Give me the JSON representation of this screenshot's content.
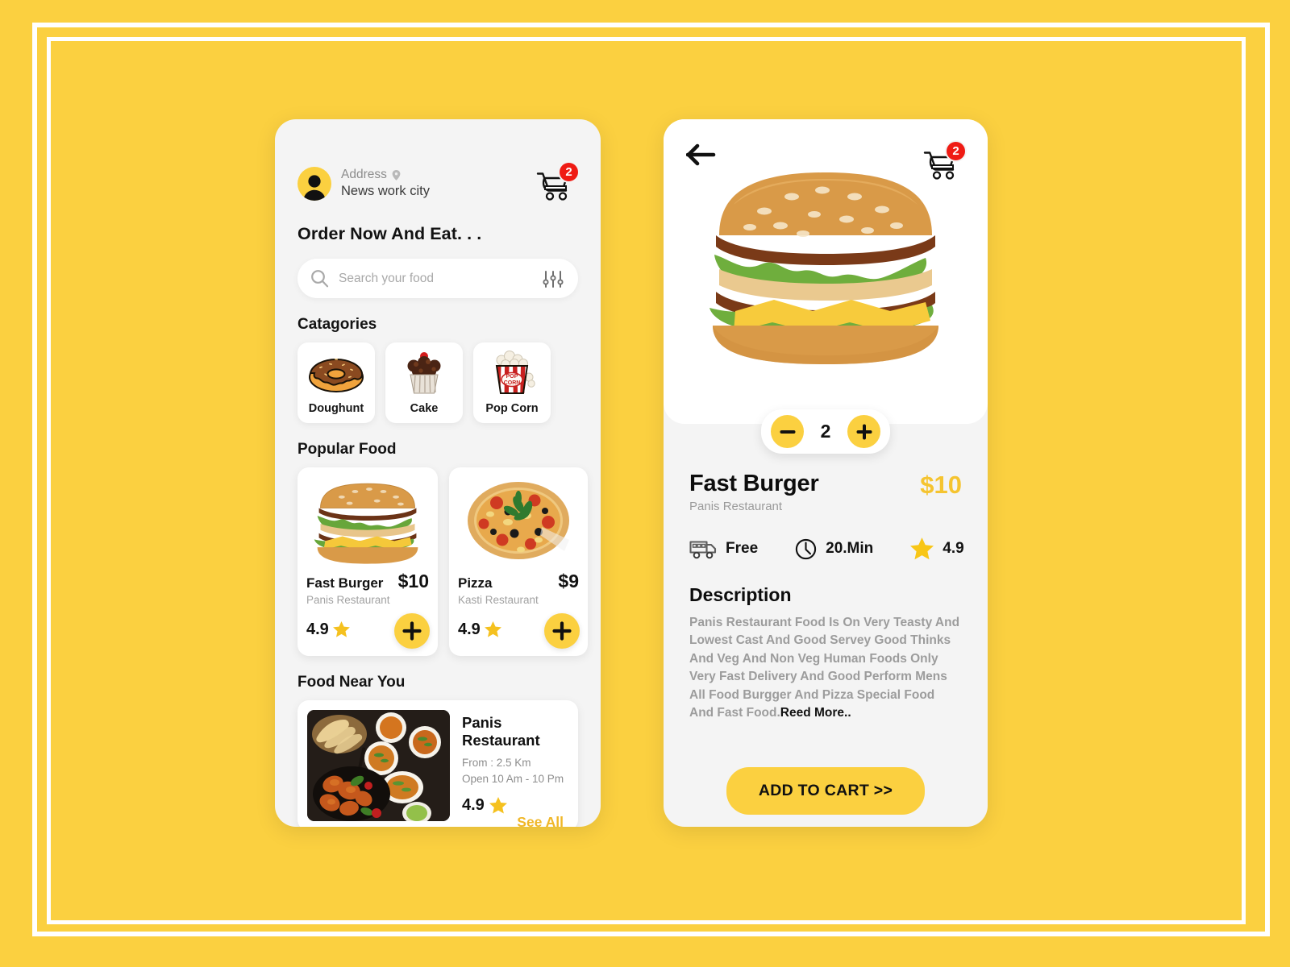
{
  "home": {
    "user": {
      "address_label": "Address",
      "address_value": "News work city",
      "avatar_icon": "person-icon",
      "pin_icon": "map-pin-icon"
    },
    "cart": {
      "icon": "shopping-cart-icon",
      "badge": "2"
    },
    "headline": "Order Now And Eat. . .",
    "search": {
      "placeholder": "Search your food",
      "value": "",
      "search_icon": "search-icon",
      "filter_icon": "filter-sliders-icon"
    },
    "categories_title": "Catagories",
    "categories": [
      {
        "label": "Doughunt",
        "icon": "doughnut-icon"
      },
      {
        "label": "Cake",
        "icon": "cupcake-icon"
      },
      {
        "label": "Pop Corn",
        "icon": "popcorn-icon"
      }
    ],
    "popular_title": "Popular Food",
    "popular": [
      {
        "name": "Fast Burger",
        "price": "$10",
        "restaurant": "Panis Restaurant",
        "rating": "4.9",
        "star_icon": "star-icon",
        "add_icon": "plus-icon",
        "image": "burger-photo"
      },
      {
        "name": "Pizza",
        "price": "$9",
        "restaurant": "Kasti Restaurant",
        "rating": "4.9",
        "star_icon": "star-icon",
        "add_icon": "plus-icon",
        "image": "pizza-photo"
      }
    ],
    "near_title": "Food Near You",
    "near": {
      "name": "Panis Restaurant",
      "distance": "From : 2.5 Km",
      "hours": "Open 10 Am - 10 Pm",
      "rating": "4.9",
      "star_icon": "star-icon",
      "see_all": "See All",
      "image": "indian-food-platter-photo"
    }
  },
  "detail": {
    "back_icon": "arrow-left-icon",
    "cart": {
      "icon": "shopping-cart-icon",
      "badge": "2"
    },
    "hero_image": "burger-photo",
    "quantity": {
      "value": "2",
      "minus_icon": "minus-icon",
      "plus_icon": "plus-icon"
    },
    "product": {
      "name": "Fast Burger",
      "restaurant": "Panis Restaurant",
      "price": "$10"
    },
    "info": [
      {
        "label": "Free",
        "icon": "delivery-van-icon"
      },
      {
        "label": "20.Min",
        "icon": "clock-icon"
      },
      {
        "label": "4.9",
        "icon": "star-icon"
      }
    ],
    "description_title": "Description",
    "description_body": "Panis Restaurant Food Is On Very Teasty And Lowest Cast And Good Servey Good Thinks And Veg And Non Veg Human Foods Only Very Fast Delivery And Good Perform Mens All Food Burgger And Pizza Special Food And Fast Food.",
    "read_more": "Reed More..",
    "cta_label": "ADD TO CART >>"
  },
  "colors": {
    "background_yellow": "#fbd040",
    "accent_yellow": "#fbd040",
    "price_yellow": "#f5c430",
    "badge_red": "#ef1b14",
    "screen_grey": "#f4f4f4",
    "card_white": "#ffffff"
  }
}
